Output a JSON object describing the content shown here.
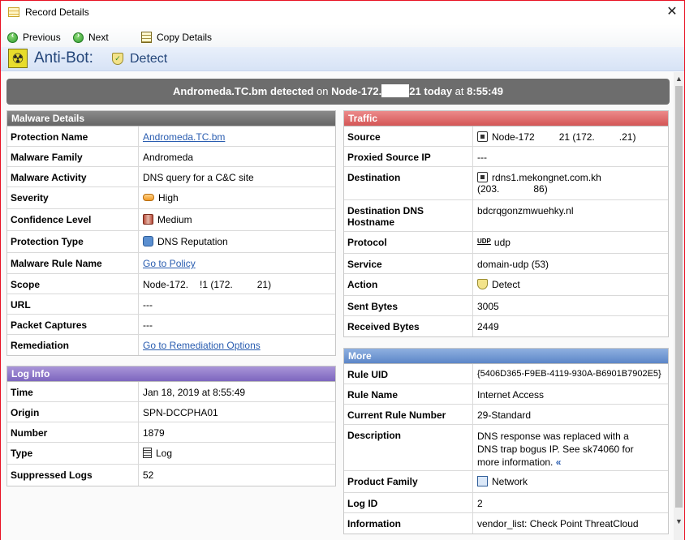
{
  "window": {
    "title": "Record Details",
    "close_glyph": "✕"
  },
  "toolbar": {
    "previous": "Previous",
    "next": "Next",
    "copy": "Copy Details"
  },
  "header": {
    "blade": "Anti-Bot:",
    "action": "Detect"
  },
  "banner": {
    "malware": "Andromeda.TC.bm",
    "detected": "detected",
    "on": "on",
    "node_start": "Node-172.",
    "node_end": "21",
    "today": "today",
    "at": "at",
    "time": "8:55:49"
  },
  "malware_details": {
    "title": "Malware Details",
    "rows": [
      {
        "key": "Protection Name",
        "value": "Andromeda.TC.bm"
      },
      {
        "key": "Malware Family",
        "value": "Andromeda"
      },
      {
        "key": "Malware Activity",
        "value": "DNS query for a C&C site"
      },
      {
        "key": "Severity",
        "value": "High"
      },
      {
        "key": "Confidence Level",
        "value": "Medium"
      },
      {
        "key": "Protection Type",
        "value": "DNS Reputation"
      },
      {
        "key": "Malware Rule Name",
        "value": "Go to Policy"
      },
      {
        "key": "Scope",
        "value": "Node-172.",
        "value_b": "!1 (172.",
        "value_c": "21)"
      },
      {
        "key": "URL",
        "value": "---"
      },
      {
        "key": "Packet Captures",
        "value": "---"
      },
      {
        "key": "Remediation",
        "value": "Go to Remediation Options"
      }
    ]
  },
  "log_info": {
    "title": "Log Info",
    "rows": [
      {
        "key": "Time",
        "value": "Jan 18, 2019 at 8:55:49"
      },
      {
        "key": "Origin",
        "value": "SPN-DCCPHA01"
      },
      {
        "key": "Number",
        "value": "1879"
      },
      {
        "key": "Type",
        "value": "Log"
      },
      {
        "key": "Suppressed Logs",
        "value": "52"
      }
    ]
  },
  "traffic": {
    "title": "Traffic",
    "rows": [
      {
        "key": "Source",
        "value": "Node-172",
        "value_b": "21 (172.",
        "value_c": ".21)"
      },
      {
        "key": "Proxied Source IP",
        "value": "---"
      },
      {
        "key": "Destination",
        "value": "rdns1.mekongnet.com.kh",
        "value_b": "(203.",
        "value_c": "86)"
      },
      {
        "key": "Destination DNS Hostname",
        "value": "bdcrqgonzmwuehky.nl"
      },
      {
        "key": "Protocol",
        "value": "udp",
        "badge": "UDP"
      },
      {
        "key": "Service",
        "value": "domain-udp (53)"
      },
      {
        "key": "Action",
        "value": "Detect"
      },
      {
        "key": "Sent Bytes",
        "value": "3005"
      },
      {
        "key": "Received Bytes",
        "value": "2449"
      }
    ]
  },
  "more": {
    "title": "More",
    "rows": [
      {
        "key": "Rule UID",
        "value": "{5406D365-F9EB-4119-930A-B6901B7902E5}"
      },
      {
        "key": "Rule Name",
        "value": "Internet Access"
      },
      {
        "key": "Current Rule Number",
        "value": "29-Standard"
      },
      {
        "key": "Description",
        "value": "DNS response was replaced with a DNS trap bogus IP. See sk74060 for more information.",
        "more_glyph": "«"
      },
      {
        "key": "Product Family",
        "value": "Network"
      },
      {
        "key": "Log ID",
        "value": "2"
      },
      {
        "key": "Information",
        "value": "vendor_list: Check Point ThreatCloud"
      }
    ]
  },
  "icons": {
    "severity": "severity-high-icon",
    "confidence": "confidence-icon",
    "protection_type": "dns-reputation-icon",
    "host": "host-icon",
    "action": "detect-shield-icon",
    "log": "log-icon",
    "product": "network-icon"
  }
}
